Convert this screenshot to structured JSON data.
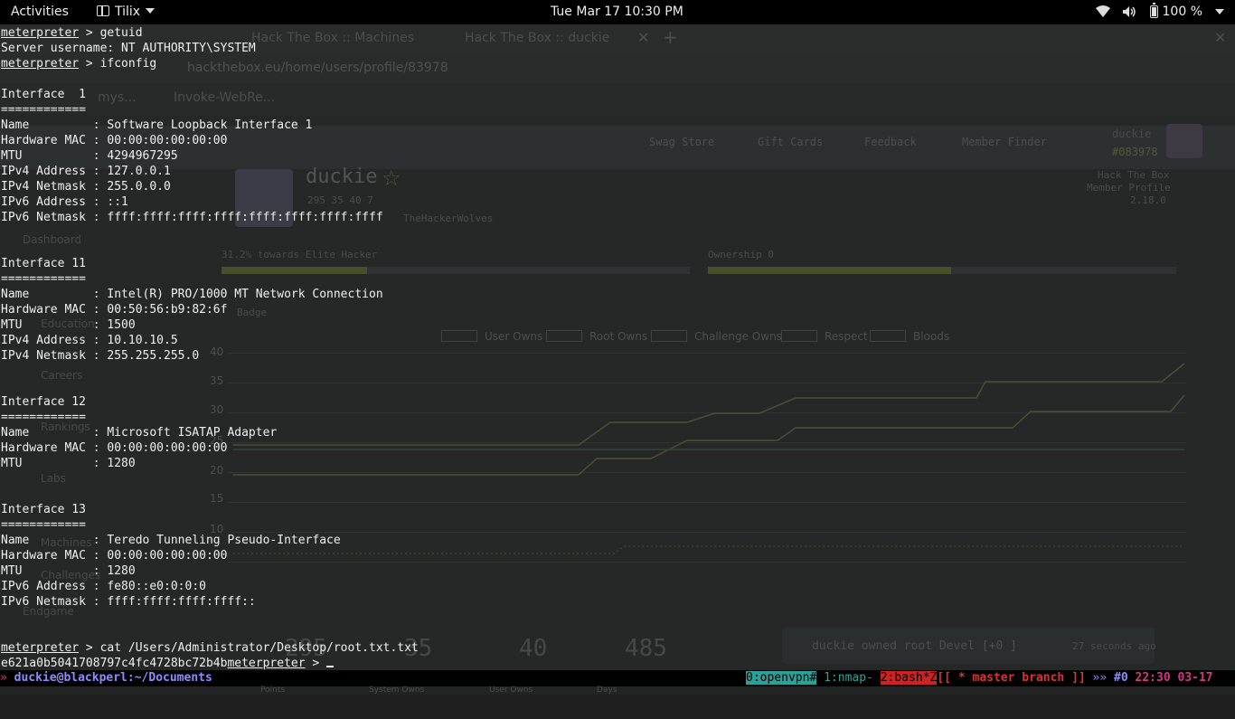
{
  "topbar": {
    "activities": "Activities",
    "app_name": "Tilix",
    "clock": "Tue Mar 17  10:30 PM",
    "battery": "100 %",
    "icons": [
      "wifi-icon",
      "volume-icon",
      "battery-icon",
      "caret-down-icon"
    ]
  },
  "background_browser": {
    "tabs": [
      {
        "label": "Hack The Box :: Machines"
      },
      {
        "label": "Hack The Box :: duckie"
      }
    ],
    "url": "hackthebox.eu/home/users/profile/83978",
    "bookmarks": [
      "mys...",
      "Invoke-WebRe..."
    ],
    "nav": [
      "Swag Store",
      "Gift Cards",
      "Feedback",
      "Member Finder"
    ],
    "profile_user": "duckie",
    "profile_id": "#083978",
    "profile_name": "duckie",
    "profile_stats": "295  35  40  7",
    "team": "TheHackerWolves",
    "profile_caption_1": "Hack The Box",
    "profile_caption_2": "Member Profile",
    "version": "2.18.0",
    "progress_label_left": "31.2% towards Elite Hacker",
    "progress_label_right": "Ownership 0",
    "progress_left": 0.31,
    "progress_right": 0.52,
    "badge": "Badge",
    "sidebar": [
      "Dashboard",
      "Education",
      "Careers",
      "Rankings",
      "Labs",
      "Machines",
      "Challenges",
      "Endgame"
    ],
    "legend": [
      "User Owns",
      "Root Owns",
      "Challenge Owns",
      "Respect",
      "Bloods"
    ],
    "y_ticks": [
      "40",
      "35",
      "30",
      "25",
      "20",
      "15",
      "10"
    ],
    "stats": [
      {
        "value": "295",
        "label": "Points"
      },
      {
        "value": "35",
        "label": "System Owns"
      },
      {
        "value": "40",
        "label": "User Owns"
      },
      {
        "value": "485",
        "label": "Days"
      }
    ],
    "notification": "duckie owned root   Devel  [+0  ]",
    "notification_time": "27 seconds ago"
  },
  "terminal": {
    "lines": [
      [
        {
          "t": "meterpreter",
          "u": true
        },
        {
          "t": " > getuid"
        }
      ],
      [
        {
          "t": "Server username: NT AUTHORITY\\SYSTEM"
        }
      ],
      [
        {
          "t": "meterpreter",
          "u": true
        },
        {
          "t": " > ifconfig"
        }
      ],
      [
        {
          "t": ""
        }
      ],
      [
        {
          "t": "Interface  1"
        }
      ],
      [
        {
          "t": "============"
        }
      ],
      [
        {
          "t": "Name         : Software Loopback Interface 1"
        }
      ],
      [
        {
          "t": "Hardware MAC : 00:00:00:00:00:00"
        }
      ],
      [
        {
          "t": "MTU          : 4294967295"
        }
      ],
      [
        {
          "t": "IPv4 Address : 127.0.0.1"
        }
      ],
      [
        {
          "t": "IPv4 Netmask : 255.0.0.0"
        }
      ],
      [
        {
          "t": "IPv6 Address : ::1"
        }
      ],
      [
        {
          "t": "IPv6 Netmask : ffff:ffff:ffff:ffff:ffff:ffff:ffff:ffff"
        }
      ],
      [
        {
          "t": ""
        }
      ],
      [
        {
          "t": ""
        }
      ],
      [
        {
          "t": "Interface 11"
        }
      ],
      [
        {
          "t": "============"
        }
      ],
      [
        {
          "t": "Name         : Intel(R) PRO/1000 MT Network Connection"
        }
      ],
      [
        {
          "t": "Hardware MAC : 00:50:56:b9:82:6f"
        }
      ],
      [
        {
          "t": "MTU          : 1500"
        }
      ],
      [
        {
          "t": "IPv4 Address : 10.10.10.5"
        }
      ],
      [
        {
          "t": "IPv4 Netmask : 255.255.255.0"
        }
      ],
      [
        {
          "t": ""
        }
      ],
      [
        {
          "t": ""
        }
      ],
      [
        {
          "t": "Interface 12"
        }
      ],
      [
        {
          "t": "============"
        }
      ],
      [
        {
          "t": "Name         : Microsoft ISATAP Adapter"
        }
      ],
      [
        {
          "t": "Hardware MAC : 00:00:00:00:00:00"
        }
      ],
      [
        {
          "t": "MTU          : 1280"
        }
      ],
      [
        {
          "t": ""
        }
      ],
      [
        {
          "t": ""
        }
      ],
      [
        {
          "t": "Interface 13"
        }
      ],
      [
        {
          "t": "============"
        }
      ],
      [
        {
          "t": "Name         : Teredo Tunneling Pseudo-Interface"
        }
      ],
      [
        {
          "t": "Hardware MAC : 00:00:00:00:00:00"
        }
      ],
      [
        {
          "t": "MTU          : 1280"
        }
      ],
      [
        {
          "t": "IPv6 Address : fe80::e0:0:0:0"
        }
      ],
      [
        {
          "t": "IPv6 Netmask : ffff:ffff:ffff:ffff::"
        }
      ],
      [
        {
          "t": ""
        }
      ],
      [
        {
          "t": ""
        }
      ],
      [
        {
          "t": "meterpreter",
          "u": true
        },
        {
          "t": " > cat /Users/Administrator/Desktop/root.txt.txt"
        }
      ],
      [
        {
          "t": "e621a0b5041708797c4fc4728bc72b4b"
        },
        {
          "t": "meterpreter",
          "u": true
        },
        {
          "t": " > "
        },
        {
          "cursor": true
        }
      ]
    ]
  },
  "statusbar": {
    "left": [
      {
        "t": "» ",
        "fg": "#d33682"
      },
      {
        "t": "duckie@blackperl:~/Documents",
        "fg": "#8c8cff",
        "bold": true
      }
    ],
    "right": [
      {
        "t": "0:openvpn#",
        "fg": "#000000",
        "bg": "#2aa198"
      },
      {
        "t": " 1:nmap- ",
        "fg": "#2aa198"
      },
      {
        "t": "2:bash*Z",
        "fg": "#000000",
        "bg": "#cc2222"
      },
      {
        "t": "[[ * master branch ]]",
        "fg": "#dc322f",
        "bold": true
      },
      {
        "t": " »» ",
        "fg": "#8c8cff"
      },
      {
        "t": "#0 ",
        "fg": "#8c8cff",
        "bold": true
      },
      {
        "t": "22:30 ",
        "fg": "#d33682",
        "bold": true
      },
      {
        "t": "03-17",
        "fg": "#d33682",
        "bold": true
      }
    ]
  },
  "colors": {
    "terminal_bg": "#1e1e1e",
    "terminal_fg": "#f0f0f0",
    "topbar_bg": "#000000",
    "statusbar_bg": "#000000"
  }
}
